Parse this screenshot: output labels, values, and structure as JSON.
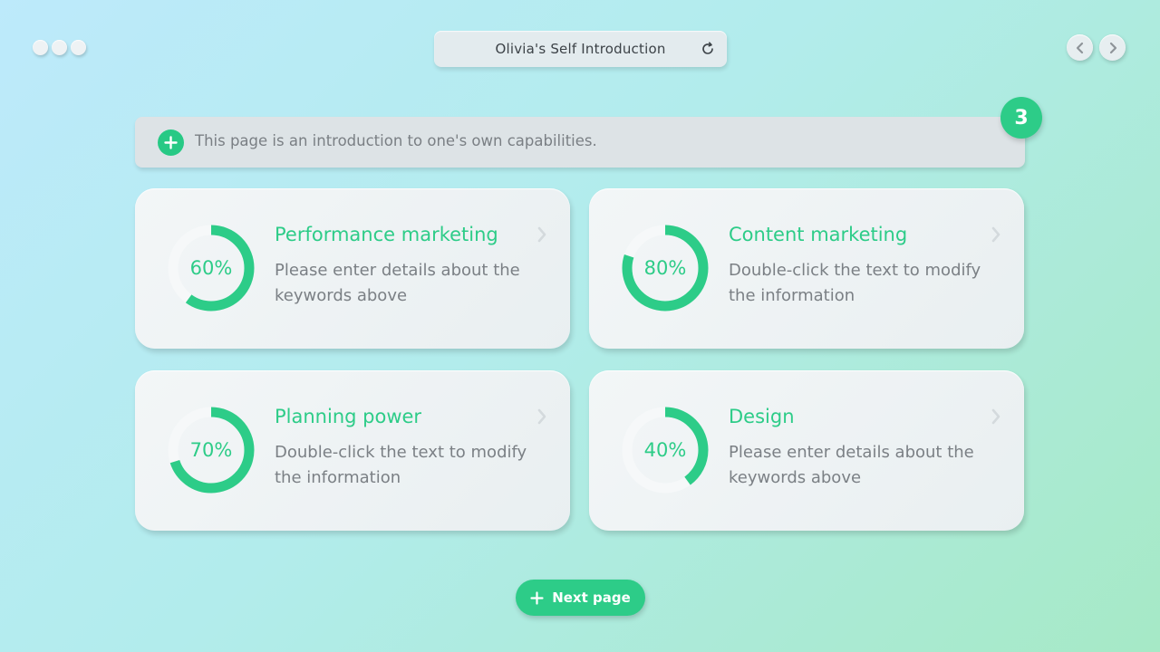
{
  "window": {
    "title": "Olivia's Self Introduction"
  },
  "info_bar": {
    "text": "This page is an introduction to one's own capabilities."
  },
  "page_badge": "3",
  "cards": [
    {
      "percent_label": "60%",
      "percent": 60,
      "title": "Performance marketing",
      "description": "Please enter details about the keywords above"
    },
    {
      "percent_label": "80%",
      "percent": 80,
      "title": "Content marketing",
      "description": "Double-click the text to modify the information"
    },
    {
      "percent_label": "70%",
      "percent": 70,
      "title": "Planning power",
      "description": "Double-click the text to modify the information"
    },
    {
      "percent_label": "40%",
      "percent": 40,
      "title": "Design",
      "description": "Please enter details about the keywords above"
    }
  ],
  "next_button": {
    "label": "Next page"
  },
  "icons": [
    "window-dot-icon",
    "refresh-icon",
    "chevron-left-icon",
    "chevron-right-icon",
    "plus-icon",
    "card-chevron-icon"
  ],
  "colors": {
    "accent": "#2dcc88",
    "track": "#f6f8f9",
    "text_muted": "#7a7f84"
  }
}
